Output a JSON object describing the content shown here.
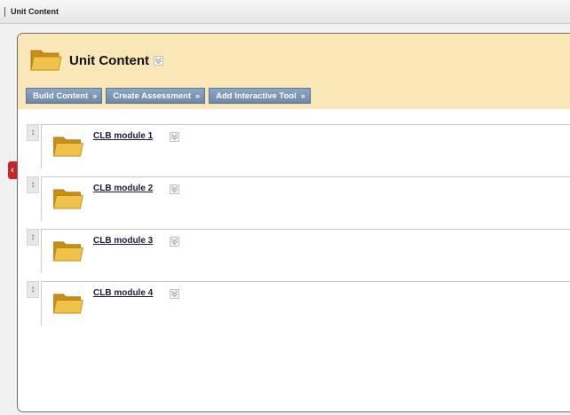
{
  "breadcrumb": {
    "current": "Unit Content"
  },
  "header": {
    "title": "Unit Content"
  },
  "toolbar": {
    "buttons": [
      {
        "label": "Build Content"
      },
      {
        "label": "Create Assessment"
      },
      {
        "label": "Add Interactive Tool"
      }
    ]
  },
  "modules": [
    {
      "title": "CLB module 1"
    },
    {
      "title": "CLB module 2"
    },
    {
      "title": "CLB module 3"
    },
    {
      "title": "CLB module 4"
    }
  ],
  "icons": {
    "folder": "folder-icon",
    "chevron": "double-chevron-down-icon",
    "drag": "drag-handle-icon",
    "collapse": "chevron-left-icon"
  },
  "colors": {
    "header_bg": "#f9e7b7",
    "button_bg": "#7890b3",
    "collapse_tab": "#c8242a",
    "folder": "#e9b52c"
  }
}
